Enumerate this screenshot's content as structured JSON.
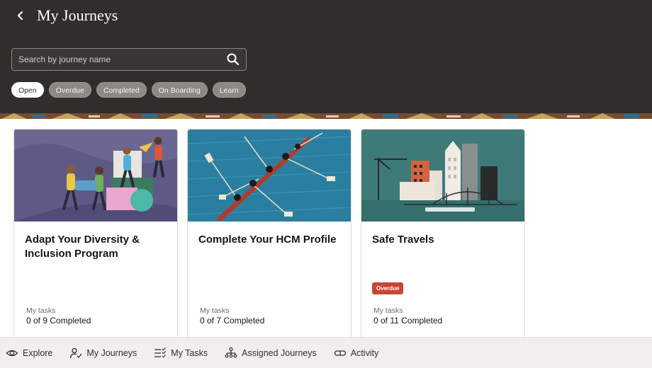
{
  "header": {
    "title": "My Journeys",
    "back_icon": "chevron-left-icon"
  },
  "search": {
    "placeholder": "Search by journey name",
    "value": "",
    "icon": "search-icon"
  },
  "filters": [
    {
      "label": "Open",
      "active": true
    },
    {
      "label": "Overdue",
      "active": false
    },
    {
      "label": "Completed",
      "active": false
    },
    {
      "label": "On Boarding",
      "active": false
    },
    {
      "label": "Learn",
      "active": false
    }
  ],
  "cards": [
    {
      "title": "Adapt Your Diversity & Inclusion Program",
      "badge": "",
      "tasks_label": "My tasks",
      "tasks_value": "0 of 9 Completed",
      "illustration": "diversity-illustration"
    },
    {
      "title": "Complete Your HCM Profile",
      "badge": "",
      "tasks_label": "My tasks",
      "tasks_value": "0 of 7 Completed",
      "illustration": "rowing-illustration"
    },
    {
      "title": "Safe Travels",
      "badge": "Overdue",
      "tasks_label": "My tasks",
      "tasks_value": "0 of 11 Completed",
      "illustration": "city-illustration"
    }
  ],
  "bottom_nav": [
    {
      "label": "Explore",
      "icon": "eye-icon"
    },
    {
      "label": "My Journeys",
      "icon": "person-check-icon"
    },
    {
      "label": "My Tasks",
      "icon": "checklist-icon"
    },
    {
      "label": "Assigned Journeys",
      "icon": "org-chart-icon"
    },
    {
      "label": "Activity",
      "icon": "pill-icon"
    }
  ],
  "colors": {
    "header_bg": "#312d2a",
    "overdue": "#c74634",
    "nav_bg": "#f1efed"
  }
}
